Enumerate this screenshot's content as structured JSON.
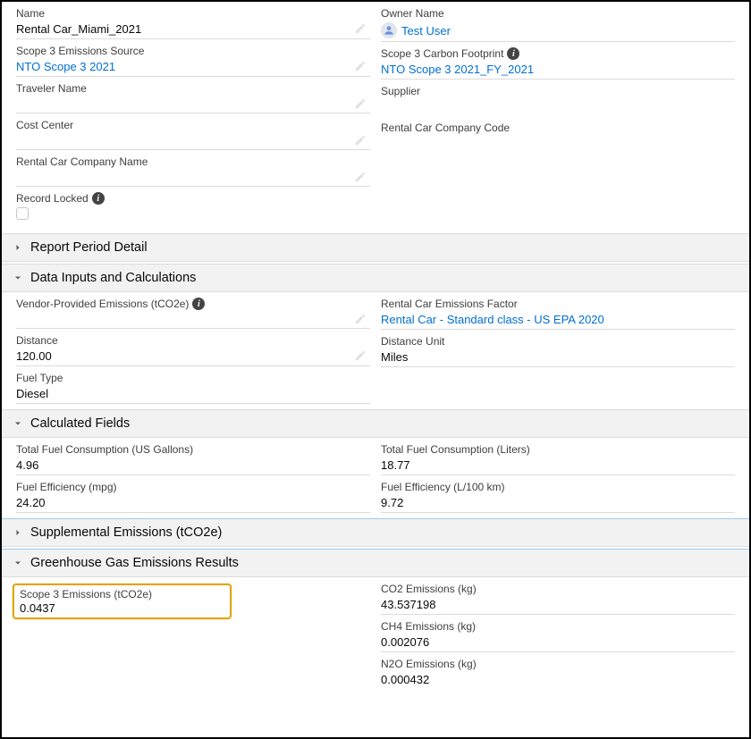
{
  "top": {
    "left": {
      "name_label": "Name",
      "name_value": "Rental Car_Miami_2021",
      "scope3_source_label": "Scope 3 Emissions Source",
      "scope3_source_value": "NTO Scope 3 2021",
      "traveler_label": "Traveler Name",
      "traveler_value": "",
      "cost_center_label": "Cost Center",
      "cost_center_value": "",
      "company_name_label": "Rental Car Company Name",
      "company_name_value": "",
      "record_locked_label": "Record Locked"
    },
    "right": {
      "owner_label": "Owner Name",
      "owner_value": "Test User",
      "scope3_fp_label": "Scope 3 Carbon Footprint",
      "scope3_fp_value": "NTO Scope 3 2021_FY_2021",
      "supplier_label": "Supplier",
      "supplier_value": "",
      "company_code_label": "Rental Car Company Code",
      "company_code_value": ""
    }
  },
  "sections": {
    "report_period": "Report Period Detail",
    "data_inputs": "Data Inputs and Calculations",
    "calculated_fields": "Calculated Fields",
    "supplemental": "Supplemental Emissions (tCO2e)",
    "ghg_results": "Greenhouse Gas Emissions Results"
  },
  "data_inputs": {
    "left": {
      "vendor_label": "Vendor-Provided Emissions (tCO2e)",
      "vendor_value": "",
      "distance_label": "Distance",
      "distance_value": "120.00",
      "fuel_type_label": "Fuel Type",
      "fuel_type_value": "Diesel"
    },
    "right": {
      "factor_label": "Rental Car Emissions Factor",
      "factor_value": "Rental Car - Standard class - US EPA 2020",
      "distance_unit_label": "Distance Unit",
      "distance_unit_value": "Miles"
    }
  },
  "calculated": {
    "left": {
      "gal_label": "Total Fuel Consumption (US Gallons)",
      "gal_value": "4.96",
      "mpg_label": "Fuel Efficiency (mpg)",
      "mpg_value": "24.20"
    },
    "right": {
      "liters_label": "Total Fuel Consumption (Liters)",
      "liters_value": "18.77",
      "l100_label": "Fuel Efficiency (L/100 km)",
      "l100_value": "9.72"
    }
  },
  "results": {
    "left": {
      "scope3_label": "Scope 3 Emissions (tCO2e)",
      "scope3_value": "0.0437"
    },
    "right": {
      "co2_label": "CO2 Emissions (kg)",
      "co2_value": "43.537198",
      "ch4_label": "CH4 Emissions (kg)",
      "ch4_value": "0.002076",
      "n2o_label": "N2O Emissions (kg)",
      "n2o_value": "0.000432"
    }
  }
}
